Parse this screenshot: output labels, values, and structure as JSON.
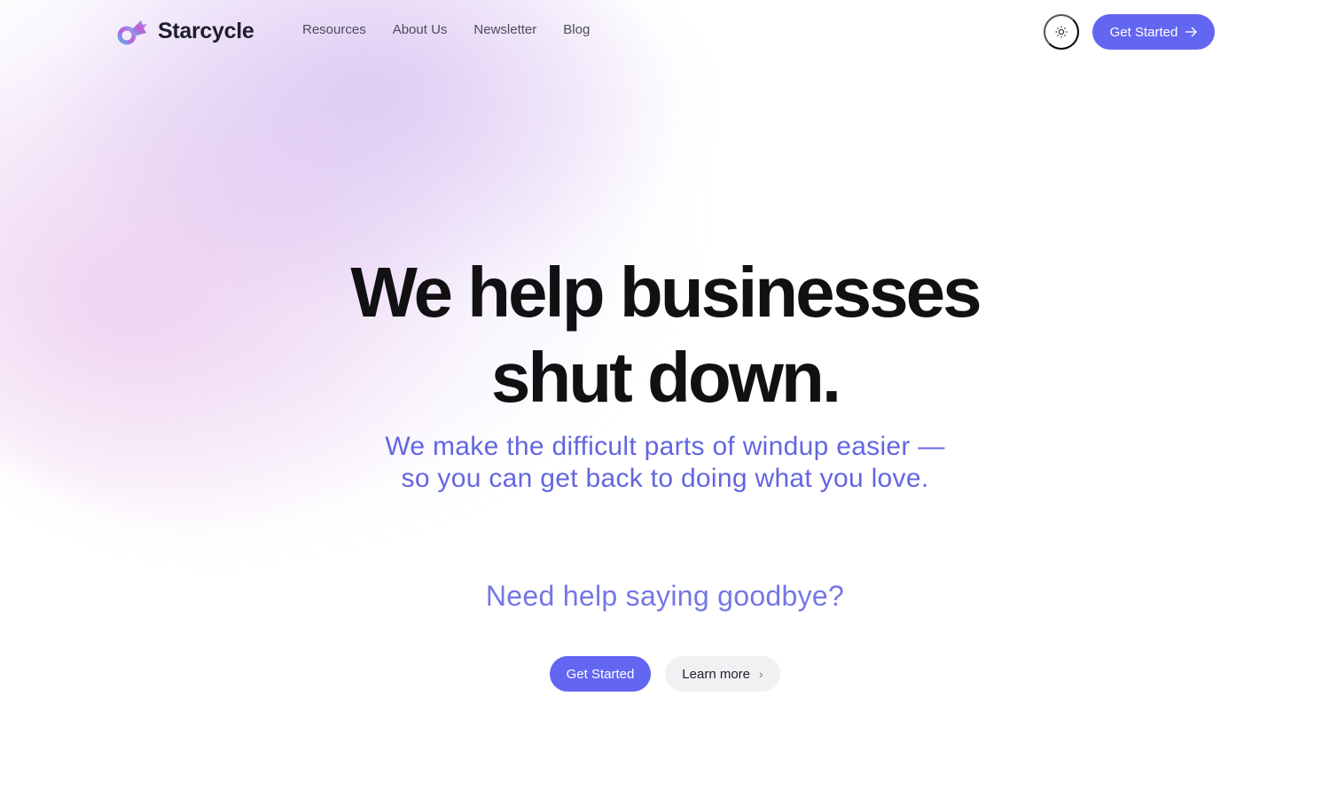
{
  "brand": {
    "name": "Starcycle",
    "logo_icon": "starcycle-logo-icon"
  },
  "nav": {
    "items": [
      {
        "label": "Resources"
      },
      {
        "label": "About Us"
      },
      {
        "label": "Newsletter"
      },
      {
        "label": "Blog"
      }
    ]
  },
  "header": {
    "theme_toggle_icon": "sun-icon",
    "cta_label": "Get Started",
    "cta_icon": "arrow-right-icon"
  },
  "hero": {
    "title_line1": "We help businesses",
    "title_line2": "shut down.",
    "subtitle_line1": "We make the difficult parts of windup easier —",
    "subtitle_line2": "so you can get back to doing what you love.",
    "question": "Need help saying goodbye?",
    "primary_cta": "Get Started",
    "secondary_cta": "Learn more",
    "secondary_icon": "chevron-right-icon"
  },
  "colors": {
    "accent": "#6366f1",
    "subtitle": "#6366e0",
    "title": "#111114"
  }
}
